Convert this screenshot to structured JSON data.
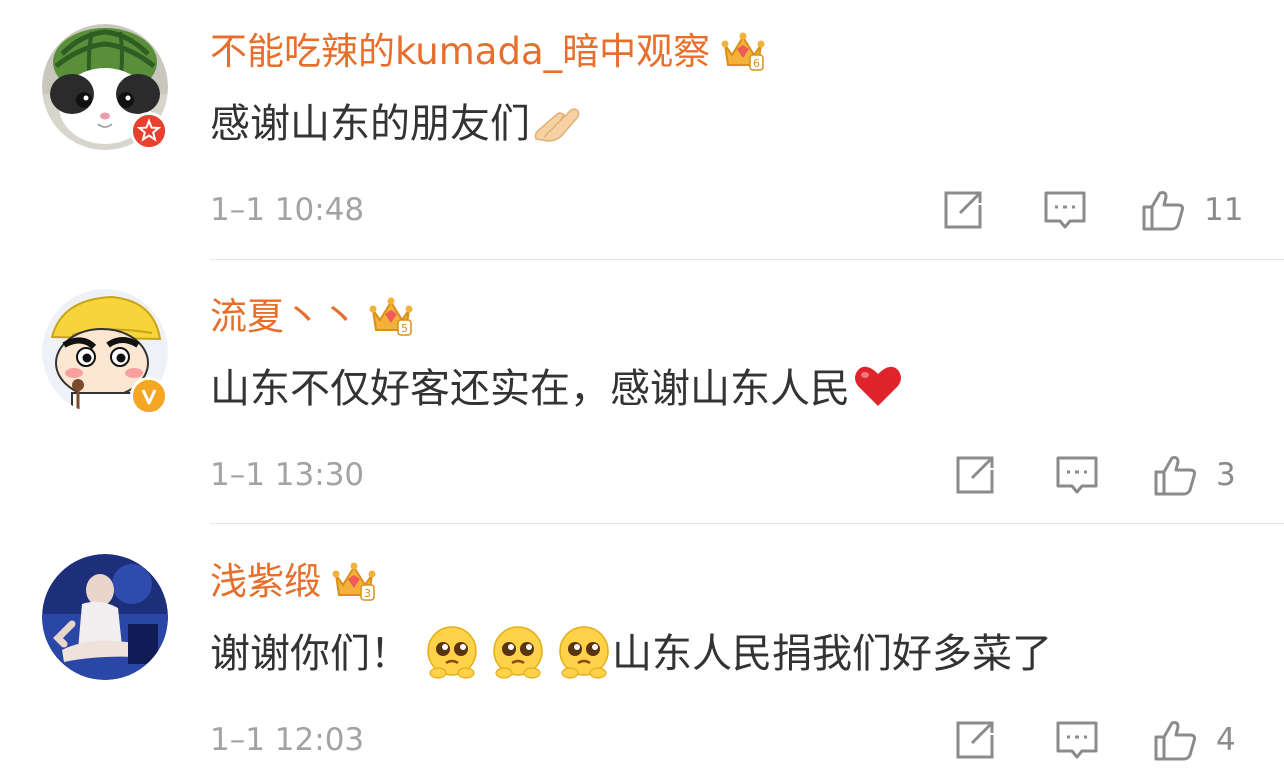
{
  "comments": [
    {
      "username": "不能吃辣的kumada_暗中观察",
      "text": "感谢山东的朋友们",
      "time": "1–1 10:48",
      "likes": "11",
      "crown_level": "6",
      "emojis": [
        "hands-together"
      ],
      "badge": "star-badge",
      "avatar": "cat-in-watermelon-hat"
    },
    {
      "username": "流夏丶丶",
      "text": "山东不仅好客还实在，感谢山东人民",
      "time": "1–1 13:30",
      "likes": "3",
      "crown_level": "5",
      "emojis": [
        "red-heart"
      ],
      "badge": "verified-v-badge",
      "avatar": "cartoon-boy-yellow-hat"
    },
    {
      "username": "浅紫缎",
      "text_before": "谢谢你们！",
      "text_after": "山东人民捐我们好多菜了",
      "time": "1–1 12:03",
      "likes": "4",
      "crown_level": "3",
      "emojis": [
        "pleading-face",
        "pleading-face",
        "pleading-face"
      ],
      "avatar": "photo-person-sitting"
    }
  ],
  "colors": {
    "username": "#e86f2b",
    "text": "#333333",
    "time": "#a3a3a3",
    "icon": "#8b8b8b"
  }
}
